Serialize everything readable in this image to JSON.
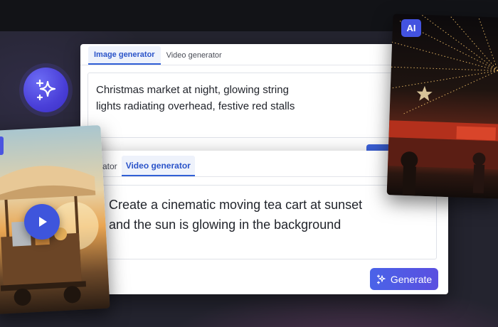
{
  "image_card": {
    "tabs": [
      "Image generator",
      "Video generator"
    ],
    "active_tab": "Image generator",
    "prompt": "Christmas market at night, glowing string\nlights radiating overhead, festive red stalls"
  },
  "video_card": {
    "tabs": [
      "ator",
      "Video generator"
    ],
    "active_tab": "Video generator",
    "prompt": "Create a cinematic moving tea cart at sunset\nand the sun is glowing in the background",
    "generate_label": "Generate"
  },
  "ai_badge": "AI",
  "icons": {
    "badge": "sparkles-icon",
    "generate": "sparkles-icon",
    "play": "play-icon"
  },
  "colors": {
    "accent": "#3e55dc",
    "generate_button": "#4a63e8",
    "active_tab_text": "#2b54c9",
    "page_background": "#24242f"
  }
}
